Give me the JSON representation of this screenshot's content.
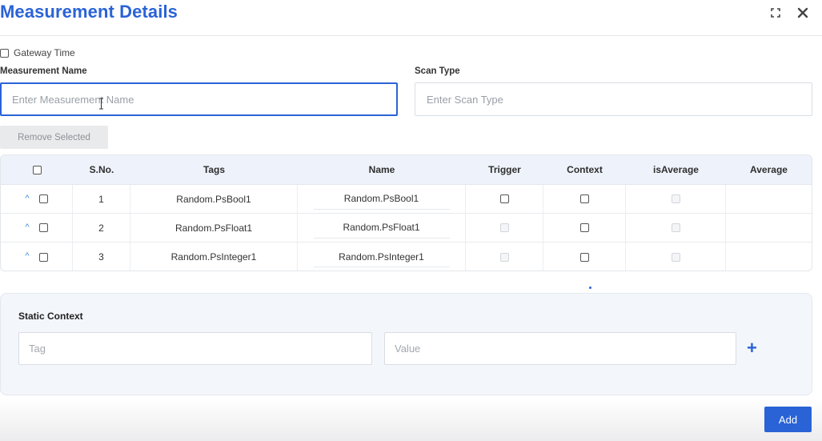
{
  "dialog": {
    "title": "Measurement Details",
    "expand_icon": "expand-icon",
    "close_icon": "close-icon"
  },
  "form": {
    "gateway_time_label": "Gateway Time",
    "measurement_name_label": "Measurement Name",
    "measurement_name_placeholder": "Enter Measurement Name",
    "scan_type_label": "Scan Type",
    "scan_type_placeholder": "Enter Scan Type"
  },
  "toolbar": {
    "remove_selected_label": "Remove Selected"
  },
  "table": {
    "headers": [
      "S.No.",
      "Tags",
      "Name",
      "Trigger",
      "Context",
      "isAverage",
      "Average"
    ],
    "rows": [
      {
        "sno": "1",
        "tag": "Random.PsBool1",
        "name": "Random.PsBool1",
        "trigger_enabled": true,
        "isaverage_enabled": false
      },
      {
        "sno": "2",
        "tag": "Random.PsFloat1",
        "name": "Random.PsFloat1",
        "trigger_enabled": false,
        "isaverage_enabled": false
      },
      {
        "sno": "3",
        "tag": "Random.PsInteger1",
        "name": "Random.PsInteger1",
        "trigger_enabled": false,
        "isaverage_enabled": false
      }
    ]
  },
  "static_context": {
    "title": "Static Context",
    "tag_placeholder": "Tag",
    "value_placeholder": "Value",
    "add_icon": "plus-icon"
  },
  "footer": {
    "add_label": "Add"
  },
  "colors": {
    "accent": "#2a63d6",
    "header_bg": "#eef2fa",
    "panel_bg": "#f3f6fb"
  }
}
